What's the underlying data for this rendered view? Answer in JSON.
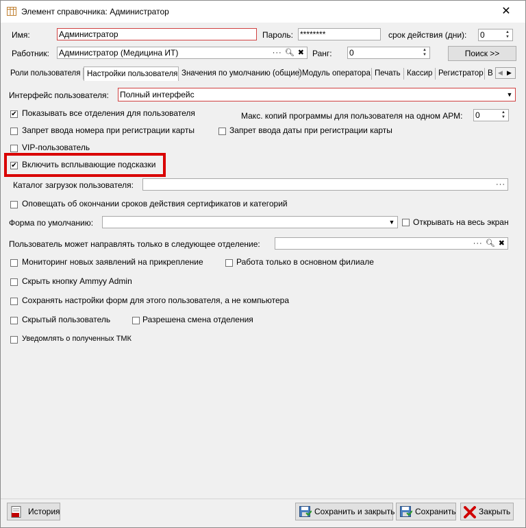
{
  "window": {
    "title": "Элемент справочника: Администратор",
    "close_glyph": "✕"
  },
  "header": {
    "name_label": "Имя:",
    "name_value": "Администратор",
    "password_label": "Пароль:",
    "password_value": "********",
    "validity_label": "срок действия (дни):",
    "validity_value": "0",
    "employee_label": "Работник:",
    "employee_value": "Администратор (Медицина ИТ)",
    "rank_label": "Ранг:",
    "rank_value": "0",
    "search_button": "Поиск  >>"
  },
  "tabs": [
    {
      "label": "Роли пользователя",
      "active": false
    },
    {
      "label": "Настройки пользователя",
      "active": true
    },
    {
      "label": "Значения по умолчанию (общие)",
      "active": false
    },
    {
      "label": "Модуль оператора",
      "active": false
    },
    {
      "label": "Печать",
      "active": false
    },
    {
      "label": "Кассир",
      "active": false
    },
    {
      "label": "Регистратор",
      "active": false
    },
    {
      "label": "В",
      "active": false
    }
  ],
  "settings": {
    "interface_label": "Интерфейс пользователя:",
    "interface_value": "Полный интерфейс",
    "show_all_depts": "Показывать все отделения для пользователя",
    "max_copies_label": "Макс. копий программы для пользователя на одном АРМ:",
    "max_copies_value": "0",
    "ban_card_number": "Запрет ввода номера при регистрации карты",
    "ban_card_date": "Запрет ввода даты при регистрации карты",
    "vip_user": "VIP-пользователь",
    "enable_tooltips": "Включить всплывающие подсказки",
    "downloads_label": "Каталог загрузок пользователя:",
    "downloads_value": "",
    "notify_certs": "Оповещать об окончании сроков действия сертификатов и категорий",
    "default_form_label": "Форма по умолчанию:",
    "default_form_value": "",
    "open_fullscreen": "Открывать на весь экран",
    "dept_direct_label": "Пользователь может направлять только в следующее отделение:",
    "dept_direct_value": "",
    "monitor_apps": "Мониторинг новых заявлений на прикрепление",
    "main_branch_only": "Работа только в основном филиале",
    "hide_ammyy": "Скрыть кнопку Ammyy Admin",
    "save_form_settings": "Сохранять настройки форм для этого пользователя, а не компьютера",
    "hidden_user": "Скрытый пользователь",
    "allow_dept_change": "Разрешена смена отделения",
    "notify_tmk": "Уведомлять о полученных ТМК"
  },
  "checks": {
    "show_all_depts": true,
    "ban_card_number": false,
    "ban_card_date": false,
    "vip_user": false,
    "enable_tooltips": true,
    "notify_certs": false,
    "open_fullscreen": false,
    "monitor_apps": false,
    "main_branch_only": false,
    "hide_ammyy": false,
    "save_form_settings": false,
    "hidden_user": false,
    "allow_dept_change": false,
    "notify_tmk": false
  },
  "footer": {
    "history_button": "История",
    "save_close_button": "Сохранить и закрыть",
    "save_button": "Сохранить",
    "close_button": "Закрыть"
  },
  "colors": {
    "highlight": "#d90000",
    "required_border": "#d04040"
  }
}
